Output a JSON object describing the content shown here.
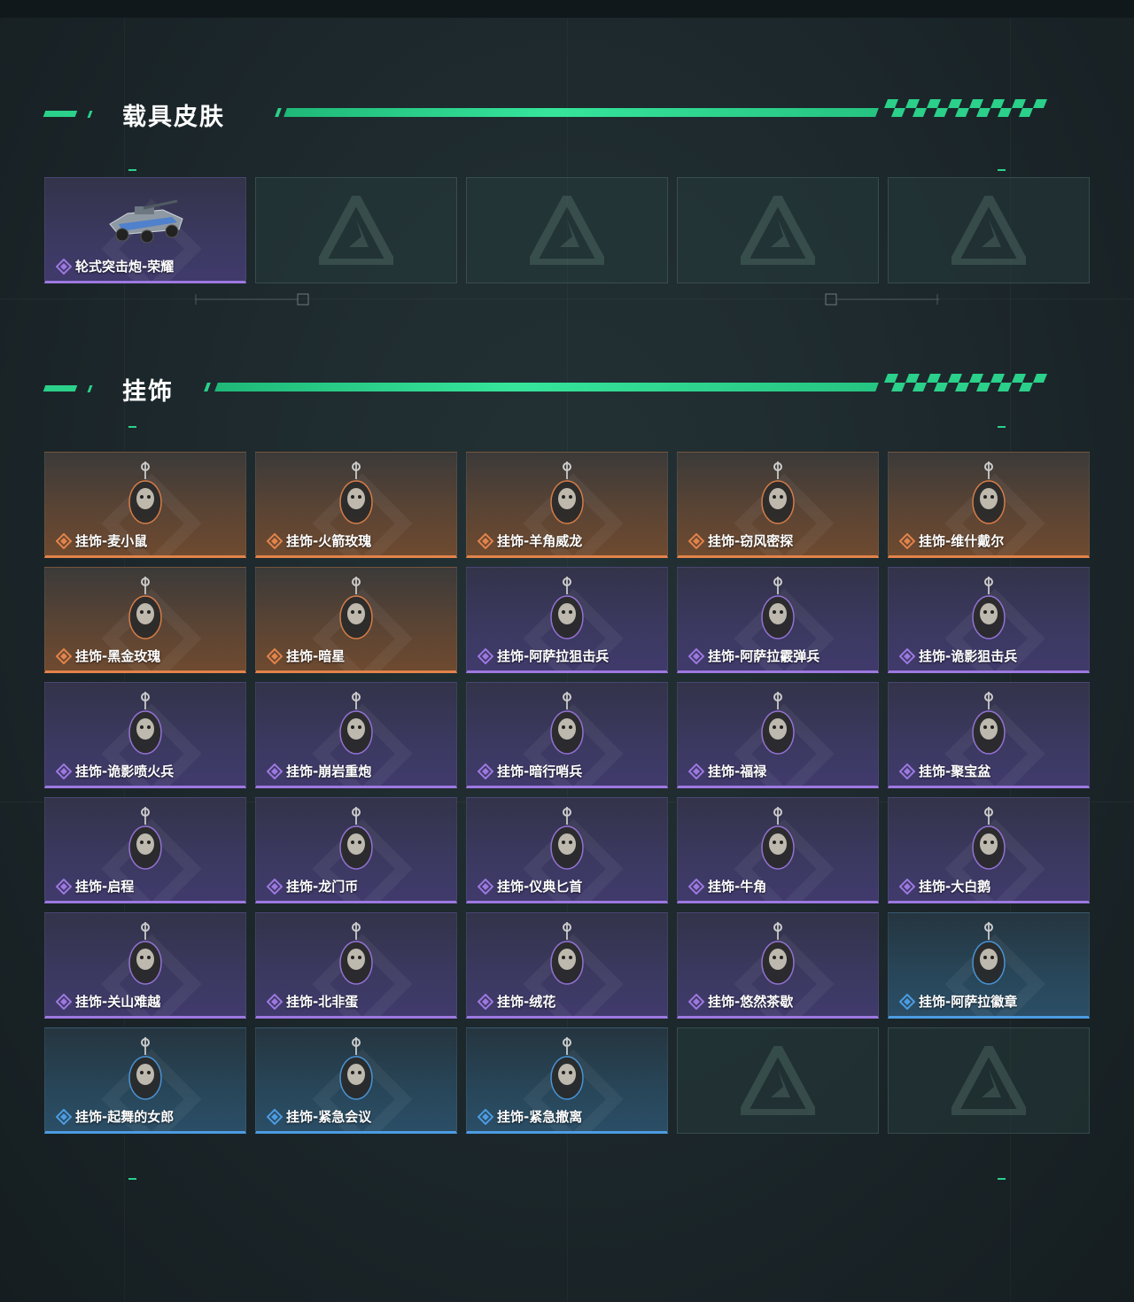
{
  "sections": {
    "vehicle": {
      "title": "载具皮肤",
      "items": [
        {
          "label": "轮式突击炮-荣耀",
          "rarity": "purple",
          "icon": "armored-vehicle-icon"
        },
        {
          "label": "",
          "rarity": "empty"
        },
        {
          "label": "",
          "rarity": "empty"
        },
        {
          "label": "",
          "rarity": "empty"
        },
        {
          "label": "",
          "rarity": "empty"
        }
      ]
    },
    "pendant": {
      "title": "挂饰",
      "items": [
        {
          "label": "挂饰-麦小鼠",
          "rarity": "orange",
          "icon": "mouse-charm-icon"
        },
        {
          "label": "挂饰-火箭玫瑰",
          "rarity": "orange",
          "icon": "rocket-rose-charm-icon"
        },
        {
          "label": "挂饰-羊角威龙",
          "rarity": "orange",
          "icon": "horned-dragon-charm-icon"
        },
        {
          "label": "挂饰-窃风密探",
          "rarity": "orange",
          "icon": "wind-spy-charm-icon"
        },
        {
          "label": "挂饰-维什戴尔",
          "rarity": "orange",
          "icon": "card-charm-icon"
        },
        {
          "label": "挂饰-黑金玫瑰",
          "rarity": "orange",
          "icon": "black-gold-rose-charm-icon"
        },
        {
          "label": "挂饰-暗星",
          "rarity": "orange",
          "icon": "dark-star-charm-icon"
        },
        {
          "label": "挂饰-阿萨拉狙击兵",
          "rarity": "purple",
          "icon": "sniper-charm-icon"
        },
        {
          "label": "挂饰-阿萨拉霰弹兵",
          "rarity": "purple",
          "icon": "shotgunner-charm-icon"
        },
        {
          "label": "挂饰-诡影狙击兵",
          "rarity": "purple",
          "icon": "shadow-sniper-charm-icon"
        },
        {
          "label": "挂饰-诡影喷火兵",
          "rarity": "purple",
          "icon": "flamethrower-charm-icon"
        },
        {
          "label": "挂饰-崩岩重炮",
          "rarity": "purple",
          "icon": "heavy-gunner-charm-icon"
        },
        {
          "label": "挂饰-暗行哨兵",
          "rarity": "purple",
          "icon": "sentry-charm-icon"
        },
        {
          "label": "挂饰-福禄",
          "rarity": "purple",
          "icon": "gourd-charm-icon"
        },
        {
          "label": "挂饰-聚宝盆",
          "rarity": "purple",
          "icon": "treasure-bowl-charm-icon"
        },
        {
          "label": "挂饰-启程",
          "rarity": "purple",
          "icon": "medallion-charm-icon"
        },
        {
          "label": "挂饰-龙门币",
          "rarity": "purple",
          "icon": "coin-charm-icon"
        },
        {
          "label": "挂饰-仪典匕首",
          "rarity": "purple",
          "icon": "dagger-charm-icon"
        },
        {
          "label": "挂饰-牛角",
          "rarity": "purple",
          "icon": "horns-charm-icon"
        },
        {
          "label": "挂饰-大白鹅",
          "rarity": "purple",
          "icon": "goose-charm-icon"
        },
        {
          "label": "挂饰-关山难越",
          "rarity": "purple",
          "icon": "gold-bar-charm-icon"
        },
        {
          "label": "挂饰-北非蛋",
          "rarity": "purple",
          "icon": "shakshuka-charm-icon"
        },
        {
          "label": "挂饰-绒花",
          "rarity": "purple",
          "icon": "red-flower-charm-icon"
        },
        {
          "label": "挂饰-悠然茶歇",
          "rarity": "purple",
          "icon": "cupcake-charm-icon"
        },
        {
          "label": "挂饰-阿萨拉徽章",
          "rarity": "blue",
          "icon": "badge-charm-icon"
        },
        {
          "label": "挂饰-起舞的女郎",
          "rarity": "blue",
          "icon": "dancer-charm-icon"
        },
        {
          "label": "挂饰-紧急会议",
          "rarity": "blue",
          "icon": "meeting-charm-icon"
        },
        {
          "label": "挂饰-紧急撤离",
          "rarity": "blue",
          "icon": "evacuation-charm-icon"
        },
        {
          "label": "",
          "rarity": "empty"
        },
        {
          "label": "",
          "rarity": "empty"
        }
      ]
    }
  },
  "colors": {
    "accent": "#2bd08a",
    "orange": "#e2834a",
    "purple": "#9d78e0",
    "blue": "#4c9ce2"
  }
}
